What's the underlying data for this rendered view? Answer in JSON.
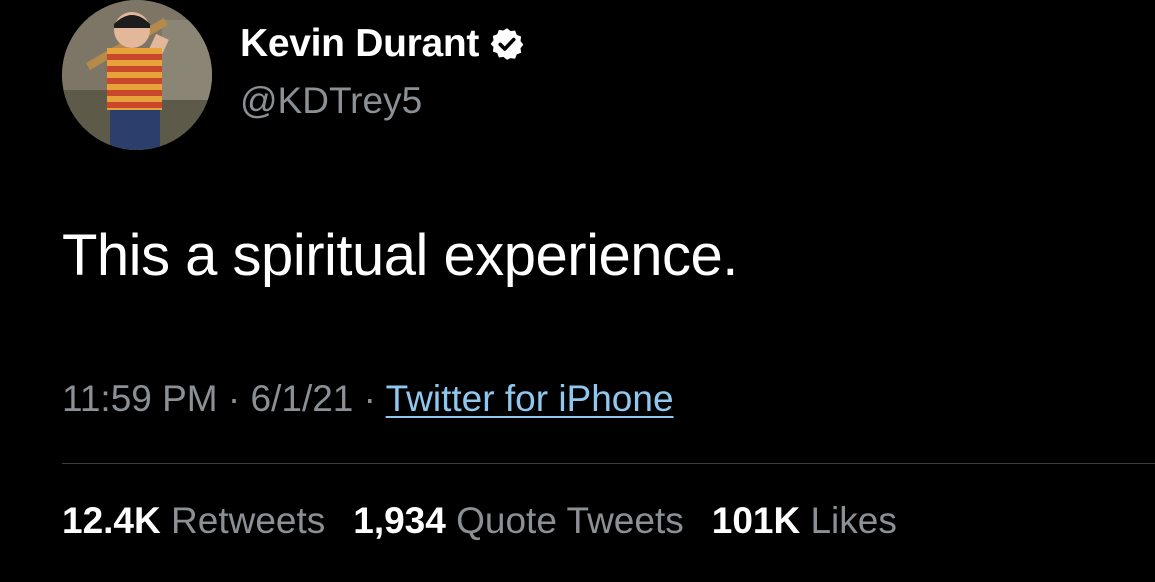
{
  "author": {
    "display_name": "Kevin Durant",
    "handle": "@KDTrey5",
    "verified": true,
    "verified_icon": "verified-badge-icon"
  },
  "tweet": {
    "text": "This a spiritual experience."
  },
  "meta": {
    "time": "11:59 PM",
    "separator1": "·",
    "date": "6/1/21",
    "separator2": "·",
    "source": "Twitter for iPhone"
  },
  "stats": {
    "retweets": {
      "count": "12.4K",
      "label": "Retweets"
    },
    "quote_tweets": {
      "count": "1,934",
      "label": "Quote Tweets"
    },
    "likes": {
      "count": "101K",
      "label": "Likes"
    }
  },
  "colors": {
    "background": "#000000",
    "text_primary": "#ffffff",
    "text_secondary": "#8b9095",
    "link": "#8fc7ee",
    "divider": "#3a3d40"
  }
}
